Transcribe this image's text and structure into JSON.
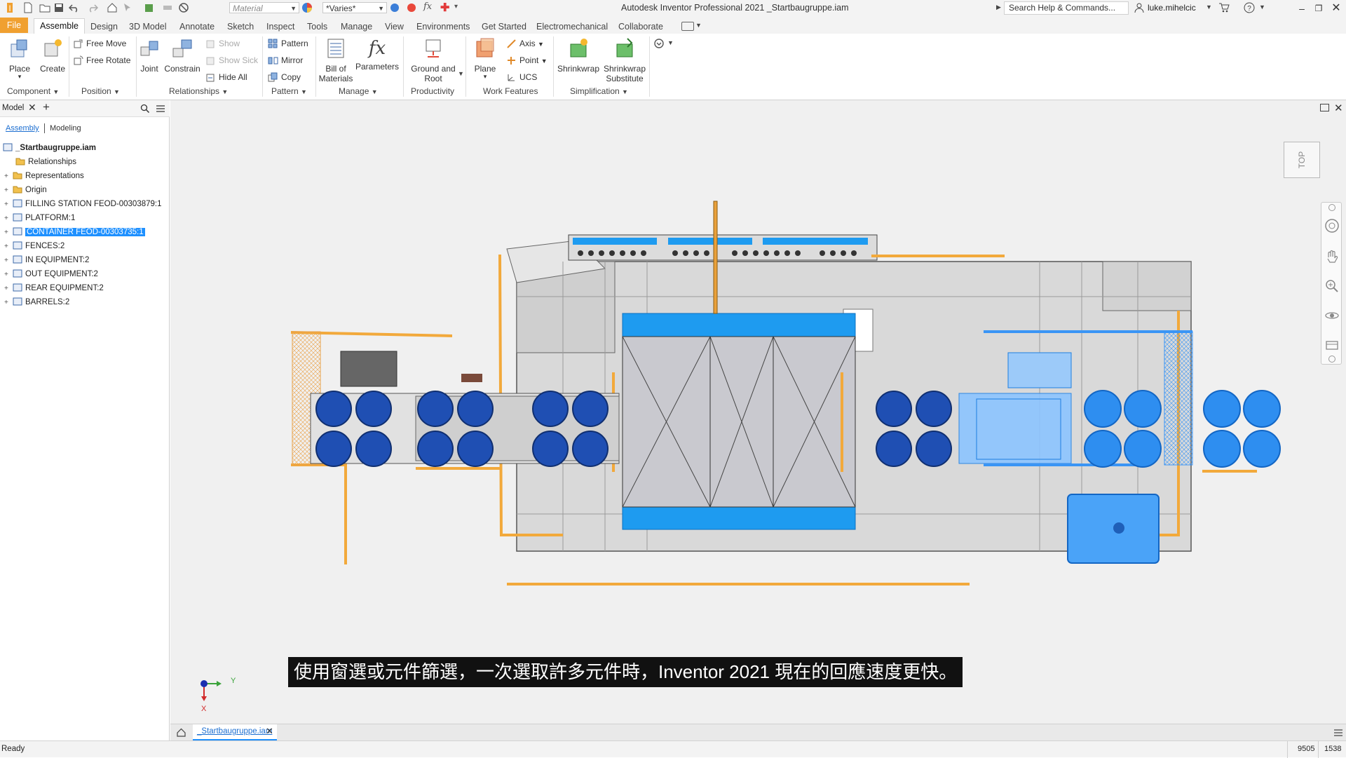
{
  "app": {
    "title": "Autodesk Inventor Professional 2021   _Startbaugruppe.iam"
  },
  "quick_access": {
    "material_placeholder": "Material",
    "appearance_value": "*Varies*",
    "search_placeholder": "Search Help & Commands...",
    "user_name": "luke.mihelcic"
  },
  "ribbon_tabs": [
    "File",
    "Assemble",
    "Design",
    "3D Model",
    "Annotate",
    "Sketch",
    "Inspect",
    "Tools",
    "Manage",
    "View",
    "Environments",
    "Get Started",
    "Electromechanical",
    "Collaborate"
  ],
  "ribbon": {
    "component": {
      "place": "Place",
      "create": "Create",
      "panel": "Component"
    },
    "position": {
      "free_move": "Free Move",
      "free_rotate": "Free Rotate",
      "panel": "Position"
    },
    "relationships": {
      "joint": "Joint",
      "constrain": "Constrain",
      "show": "Show",
      "show_sick": "Show Sick",
      "hide_all": "Hide All",
      "panel": "Relationships"
    },
    "pattern": {
      "pattern": "Pattern",
      "mirror": "Mirror",
      "copy": "Copy",
      "panel": "Pattern"
    },
    "manage": {
      "bom_line1": "Bill of",
      "bom_line2": "Materials",
      "parameters": "Parameters",
      "panel": "Manage"
    },
    "productivity": {
      "ground_line1": "Ground and",
      "ground_line2": "Root",
      "panel": "Productivity"
    },
    "work_features": {
      "plane": "Plane",
      "axis": "Axis",
      "point": "Point",
      "ucs": "UCS",
      "panel": "Work Features"
    },
    "simplification": {
      "shrinkwrap": "Shrinkwrap",
      "sub_line1": "Shrinkwrap",
      "sub_line2": "Substitute",
      "panel": "Simplification"
    }
  },
  "browser": {
    "tab_label": "Model",
    "mode_assembly": "Assembly",
    "mode_modeling": "Modeling",
    "tree": [
      "_Startbaugruppe.iam",
      "Relationships",
      "Representations",
      "Origin",
      "FILLING STATION FEOD-00303879:1",
      "PLATFORM:1",
      "CONTAINER FEOD-00303735:1",
      "FENCES:2",
      "IN EQUIPMENT:2",
      "OUT EQUIPMENT:2",
      "REAR EQUIPMENT:2",
      "BARRELS:2"
    ]
  },
  "viewcube": {
    "face": "TOP"
  },
  "triad": {
    "y": "Y",
    "x": "X"
  },
  "subtitle": "使用窗選或元件篩選，一次選取許多元件時，Inventor 2021 現在的回應速度更快。",
  "doc_tab": "_Startbaugruppe.iam",
  "status": {
    "text": "Ready",
    "count1": "9505",
    "count2": "1538"
  },
  "colors": {
    "file_tab": "#f0a030",
    "selection": "#1e90ff",
    "frame": "#f2a93b",
    "viewport_bg": "#f0f0f0"
  }
}
